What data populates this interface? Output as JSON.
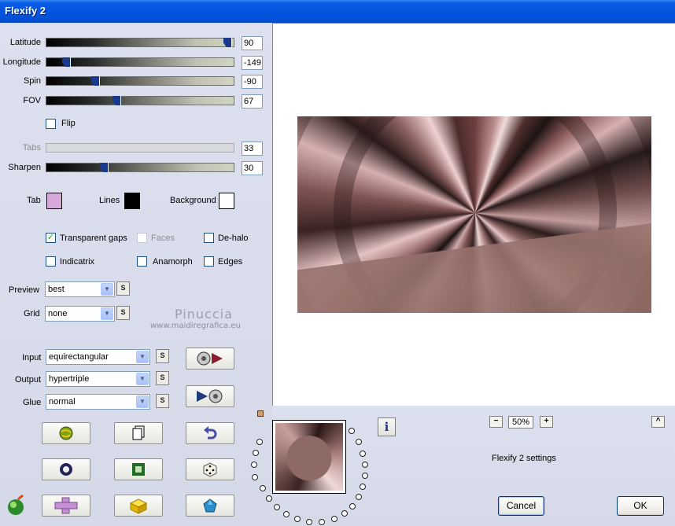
{
  "window": {
    "title": "Flexify 2"
  },
  "sliders": {
    "latitude": {
      "label": "Latitude",
      "value": "90",
      "fraction": 0.99
    },
    "longitude": {
      "label": "Longitude",
      "value": "-149",
      "fraction": 0.09
    },
    "spin": {
      "label": "Spin",
      "value": "-90",
      "fraction": 0.25
    },
    "fov": {
      "label": "FOV",
      "value": "67",
      "fraction": 0.37
    },
    "tabs": {
      "label": "Tabs",
      "value": "33"
    },
    "sharpen": {
      "label": "Sharpen",
      "value": "30",
      "fraction": 0.3
    }
  },
  "flip": {
    "label": "Flip",
    "checked": false
  },
  "colors": {
    "tab": {
      "label": "Tab",
      "color": "#d8a8d8"
    },
    "lines": {
      "label": "Lines",
      "color": "#000000"
    },
    "background": {
      "label": "Background",
      "color": "#ffffff"
    }
  },
  "options": {
    "transparent_gaps": {
      "label": "Transparent gaps",
      "checked": true
    },
    "faces": {
      "label": "Faces",
      "checked": false
    },
    "de_halo": {
      "label": "De-halo",
      "checked": false
    },
    "indicatrix": {
      "label": "Indicatrix",
      "checked": false
    },
    "anamorph": {
      "label": "Anamorph",
      "checked": false
    },
    "edges": {
      "label": "Edges",
      "checked": false
    }
  },
  "dropdowns": {
    "preview": {
      "label": "Preview",
      "value": "best"
    },
    "grid": {
      "label": "Grid",
      "value": "none"
    },
    "input": {
      "label": "Input",
      "value": "equirectangular"
    },
    "output": {
      "label": "Output",
      "value": "hypertriple"
    },
    "glue": {
      "label": "Glue",
      "value": "normal"
    }
  },
  "s_button_label": "S",
  "watermark": {
    "name": "Pinuccia",
    "site": "www.maidiregrafica.eu"
  },
  "zoom": {
    "minus": "−",
    "value": "50%",
    "plus": "+"
  },
  "up_button": "^",
  "info_button": "i",
  "status_text": "Flexify 2 settings",
  "buttons": {
    "cancel": "Cancel",
    "ok": "OK"
  },
  "icons": {
    "input_convert": "disc-to-arrow-icon",
    "output_convert": "arrow-to-disc-icon",
    "tools": [
      "globe-icon",
      "copy-icon",
      "undo-icon",
      "ring-icon",
      "frame-icon",
      "dice-icon",
      "cross-icon",
      "cube-icon",
      "gem-icon",
      "logo-icon"
    ]
  }
}
